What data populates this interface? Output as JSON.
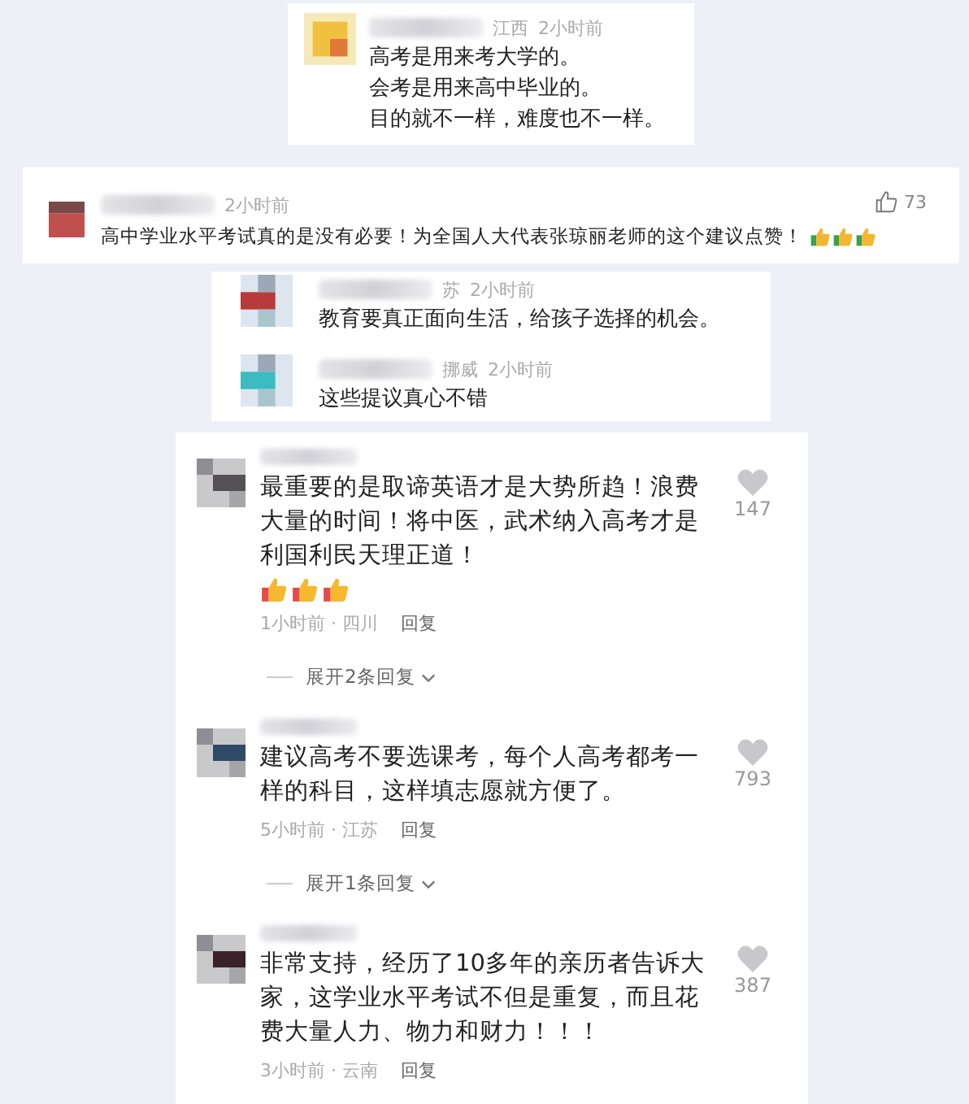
{
  "card_1": {
    "location": "江西",
    "time": "2小时前",
    "color": "#f0c040",
    "lines": [
      "高考是用来考大学的。",
      "会考是用来高中毕业的。",
      "目的就不一样，难度也不一样。"
    ]
  },
  "card_2": {
    "time": "2小时前",
    "likes": "73",
    "color": "#c0504d",
    "text": "高中学业水平考试真的是没有必要！为全国人大代表张琼丽老师的这个建议点赞！",
    "reactions": [
      {
        "kind": "thumbs-up"
      },
      {
        "kind": "thumbs-up"
      },
      {
        "kind": "thumbs-up"
      }
    ]
  },
  "card_3": {
    "comments": [
      {
        "location": "苏",
        "time": "2小时前",
        "color": "#b83a3a",
        "text": "教育要真正面向生活，给孩子选择的机会。"
      },
      {
        "location": "挪威",
        "time": "2小时前",
        "color": "#3bbcc0",
        "text": "这些提议真心不错"
      }
    ]
  },
  "card_4": {
    "comments": [
      {
        "color": "#555055",
        "text": "最重要的是取谛英语才是大势所趋！浪费大量的时间！将中医，武术纳入高考才是利国利民天理正道！",
        "reactions": [
          {
            "kind": "thumbs-up"
          },
          {
            "kind": "thumbs-up"
          },
          {
            "kind": "thumbs-up"
          }
        ],
        "meta": "1小时前 · 四川",
        "reply": "回复",
        "likes": "147",
        "expand": "展开2条回复"
      },
      {
        "color": "#2e4a66",
        "text": "建议高考不要选课考，每个人高考都考一样的科目，这样填志愿就方便了。",
        "meta": "5小时前 · 江苏",
        "reply": "回复",
        "likes": "793",
        "expand": "展开1条回复"
      },
      {
        "color": "#3a2228",
        "text": "非常支持，经历了10多年的亲历者告诉大家，这学业水平考试不但是重复，而且花费大量人力、物力和财力！！！",
        "meta": "3小时前 · 云南",
        "reply": "回复",
        "likes": "387"
      }
    ]
  }
}
